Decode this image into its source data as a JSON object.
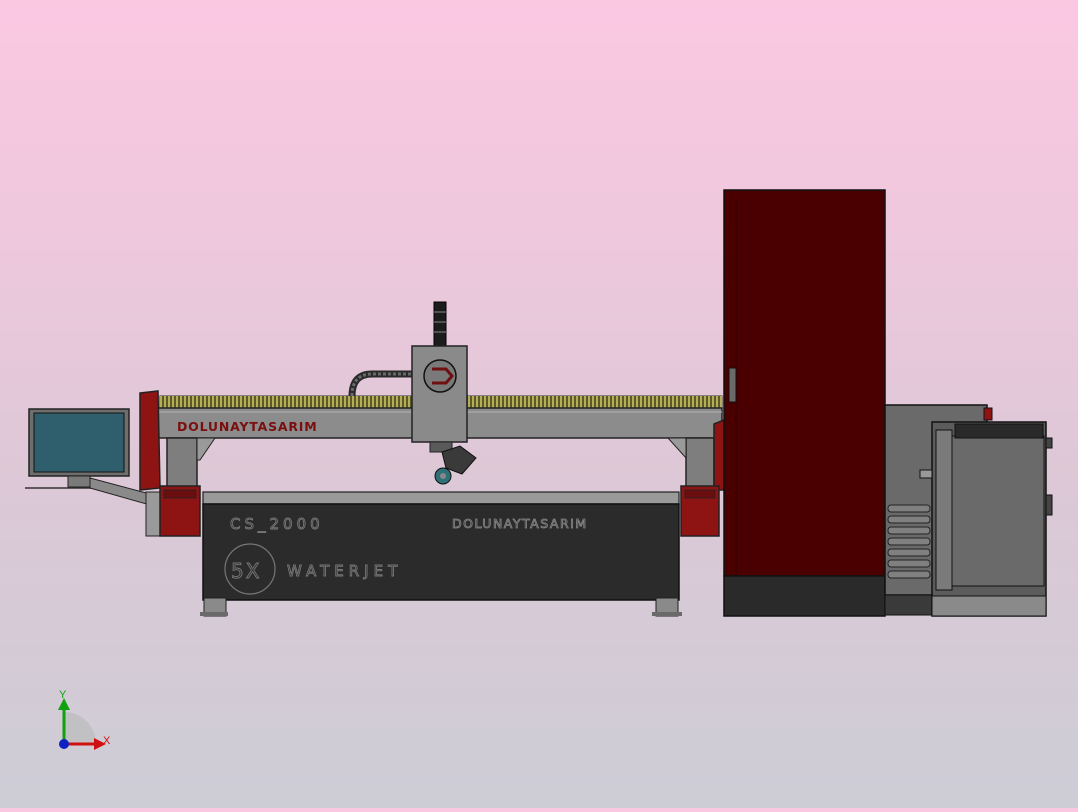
{
  "viewport": {
    "background_top": "#fbc8e2",
    "background_bottom": "#cdcdd6"
  },
  "model": {
    "brand_gantry": "DOLUNAYTASARIM",
    "model_name": "CS_2000",
    "brand_base": "DOLUNAYTASARIM",
    "logo_mark": "5X",
    "product": "WATERJET",
    "colors": {
      "cabinet": "#4a0000",
      "accent_red": "#8e1414",
      "steel": "#8a8a8a",
      "dark_base": "#2b2b2b",
      "monitor_screen": "#2f5f6c"
    }
  },
  "triad": {
    "x_label": "X",
    "y_label": "Y",
    "x_color": "#d01010",
    "y_color": "#10a010",
    "z_color": "#1020c0"
  }
}
